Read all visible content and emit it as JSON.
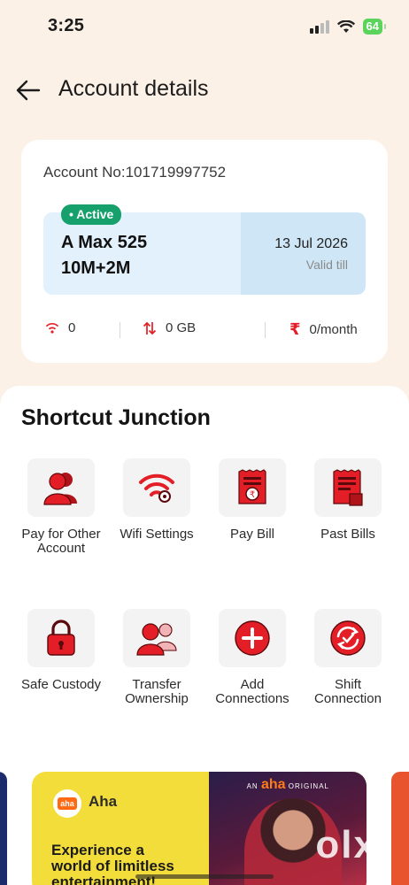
{
  "status_bar": {
    "time": "3:25",
    "battery": "64"
  },
  "header": {
    "title": "Account details"
  },
  "account": {
    "account_no": "Account No:101719997752",
    "status": "Active",
    "plan_name_line1": "A Max 525",
    "plan_name_line2": "10M+2M",
    "valid_date": "13 Jul 2026",
    "valid_label": "Valid till",
    "stats": {
      "devices": "0",
      "data": "0 GB",
      "amount": "0/month"
    }
  },
  "shortcuts": {
    "title": "Shortcut Junction",
    "items": [
      {
        "label_line1": "Pay for Other",
        "label_line2": "Account",
        "icon": "users-icon"
      },
      {
        "label_line1": "Wifi Settings",
        "label_line2": "",
        "icon": "wifi-settings-icon"
      },
      {
        "label_line1": "Pay Bill",
        "label_line2": "",
        "icon": "bill-rupee-icon"
      },
      {
        "label_line1": "Past Bills",
        "label_line2": "",
        "icon": "past-bills-icon"
      },
      {
        "label_line1": "Safe Custody",
        "label_line2": "",
        "icon": "lock-icon"
      },
      {
        "label_line1": "Transfer",
        "label_line2": "Ownership",
        "icon": "transfer-users-icon"
      },
      {
        "label_line1": "Add",
        "label_line2": "Connections",
        "icon": "plus-circle-icon"
      },
      {
        "label_line1": "Shift",
        "label_line2": "Connection",
        "icon": "shift-circle-icon"
      }
    ]
  },
  "banner": {
    "brand": "Aha",
    "logo_text": "aha",
    "art_caption_pre": "AN",
    "art_caption_brand": "aha",
    "art_caption_post": "ORIGINAL",
    "tagline_line1": "Experience a",
    "tagline_line2": "world of limitless",
    "tagline_line3": "entertainment!"
  },
  "watermark": "olx",
  "colors": {
    "accent_red": "#e41e26",
    "active_green": "#16a06b",
    "background": "#fcf1e6"
  }
}
